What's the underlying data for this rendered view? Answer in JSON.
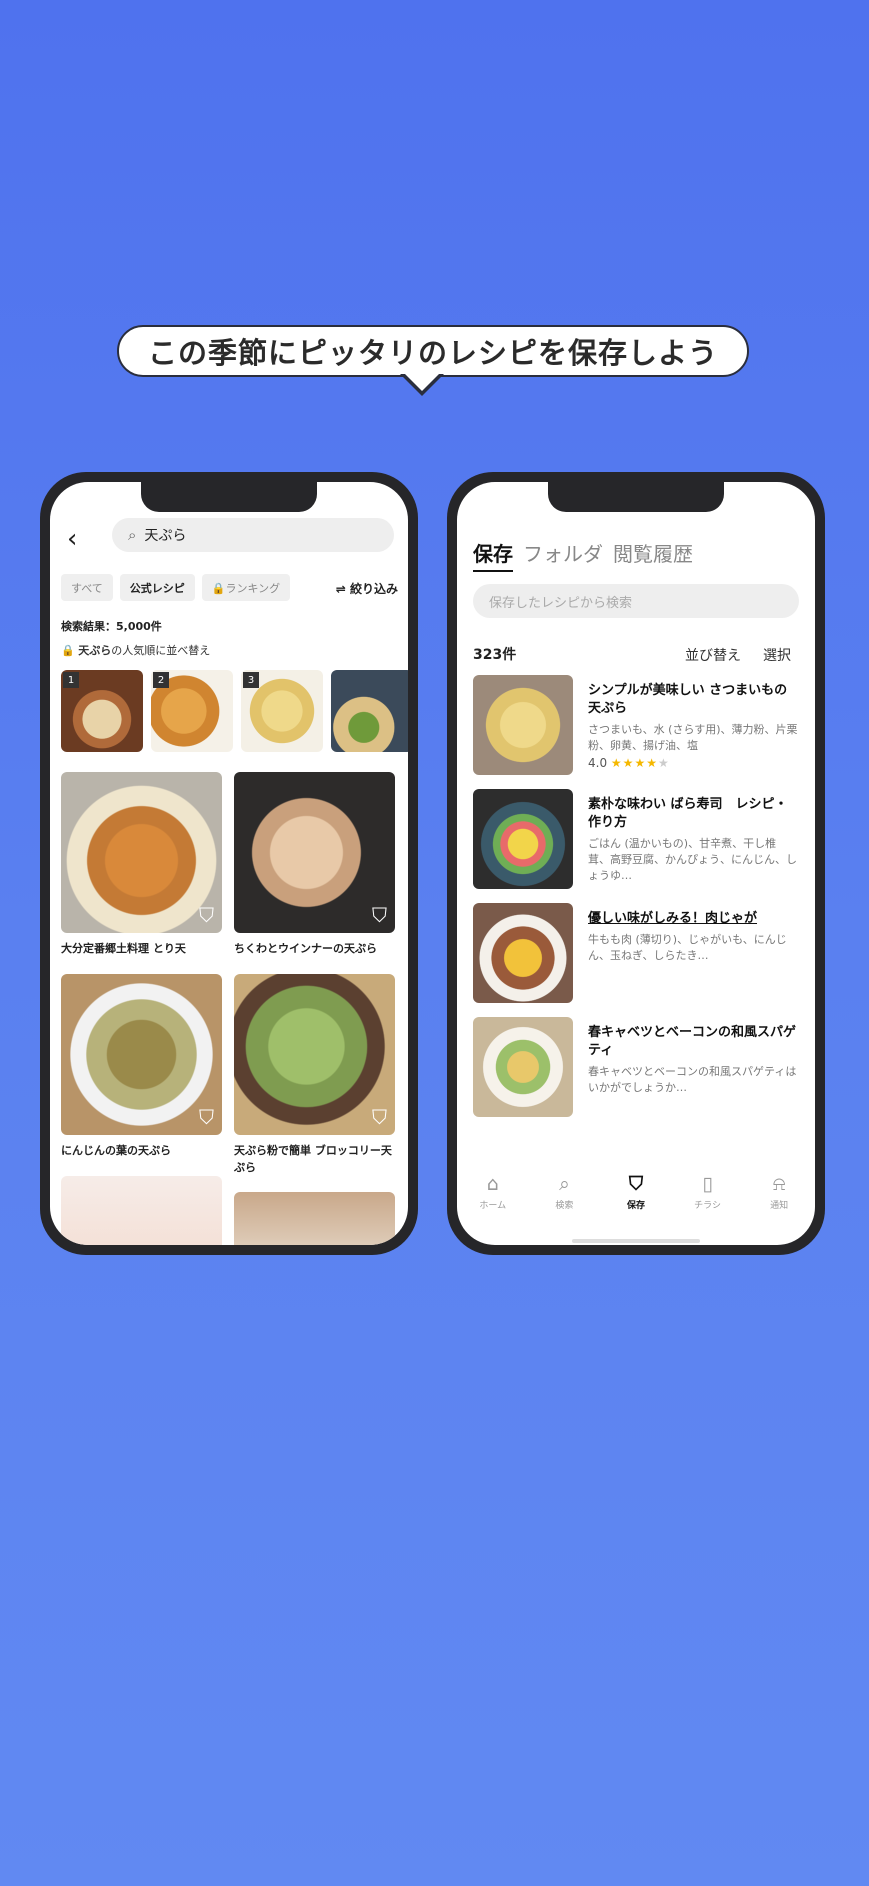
{
  "banner": {
    "text": "この季節にピッタリのレシピを保存しよう"
  },
  "search_screen": {
    "back_icon": "chevron-left-icon",
    "search_query": "天ぷら",
    "chips": [
      {
        "label": "すべて",
        "active": false
      },
      {
        "label": "公式レシピ",
        "active": true
      },
      {
        "label": "🔒ランキング",
        "active": false
      }
    ],
    "filter_label": "絞り込み",
    "result_count": "検索結果：5,000件",
    "sort_prefix": "天ぷら",
    "sort_suffix": "の人気順に並べ替え",
    "ranking_numbers": [
      "1",
      "2",
      "3",
      ""
    ],
    "cards": [
      {
        "title": "大分定番郷土料理 とり天"
      },
      {
        "title": "ちくわとウインナーの天ぷら"
      },
      {
        "title": "にんじんの葉の天ぷら"
      },
      {
        "title": "天ぷら粉で簡単 ブロッコリー天ぷら"
      }
    ]
  },
  "saved_screen": {
    "tabs": [
      "保存",
      "フォルダ",
      "閲覧履歴"
    ],
    "search_placeholder": "保存したレシピから検索",
    "count": "323件",
    "sort_label": "並び替え",
    "select_label": "選択",
    "recipes": [
      {
        "title": "シンプルが美味しい さつまいもの天ぷら",
        "desc": "さつまいも、水 (さらす用)、薄力粉、片栗粉、卵黄、揚げ油、塩",
        "rating": "4.0",
        "stars": 4
      },
      {
        "title": "素朴な味わい ばら寿司　レシピ・作り方",
        "desc": "ごはん (温かいもの)、甘辛煮、干し椎茸、高野豆腐、かんぴょう、にんじん、しょうゆ…"
      },
      {
        "title": "優しい味がしみる！肉じゃが",
        "desc": "牛もも肉 (薄切り)、じゃがいも、にんじん、玉ねぎ、しらたき…"
      },
      {
        "title": "春キャベツとベーコンの和風スパゲティ",
        "desc": "春キャベツとベーコンの和風スパゲティはいかがでしょうか…"
      }
    ],
    "nav": [
      {
        "label": "ホーム",
        "icon": "home-icon"
      },
      {
        "label": "検索",
        "icon": "search-icon"
      },
      {
        "label": "保存",
        "icon": "bookmark-icon",
        "active": true
      },
      {
        "label": "チラシ",
        "icon": "flyer-icon"
      },
      {
        "label": "通知",
        "icon": "bell-icon"
      }
    ]
  }
}
